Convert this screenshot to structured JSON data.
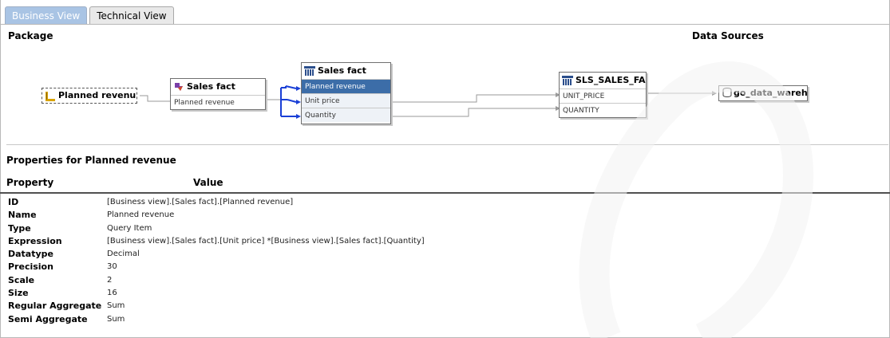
{
  "tabs": [
    {
      "label": "Business View",
      "active": false
    },
    {
      "label": "Technical View",
      "active": true
    }
  ],
  "headers": {
    "package": "Package",
    "data_sources": "Data Sources"
  },
  "diagram": {
    "query_item": {
      "label": "Planned revenu"
    },
    "sales_fact_business": {
      "title": "Sales fact",
      "rows": [
        "Planned revenue"
      ]
    },
    "sales_fact_physical": {
      "title": "Sales fact",
      "rows": [
        "Planned revenue",
        "Unit price",
        "Quantity"
      ],
      "selected_row": "Planned revenue"
    },
    "sls_table": {
      "title": "SLS_SALES_FA(",
      "rows": [
        "UNIT_PRICE",
        "QUANTITY"
      ]
    },
    "datasource": {
      "title": "go_data_wareh"
    }
  },
  "properties_title": "Properties for Planned revenue",
  "columns": {
    "property": "Property",
    "value": "Value"
  },
  "properties": [
    {
      "name": "ID",
      "value": "[Business view].[Sales fact].[Planned revenue]"
    },
    {
      "name": "Name",
      "value": "Planned revenue"
    },
    {
      "name": "Type",
      "value": "Query Item"
    },
    {
      "name": "Expression",
      "value": "[Business view].[Sales fact].[Unit price] *[Business view].[Sales fact].[Quantity]"
    },
    {
      "name": "Datatype",
      "value": "Decimal"
    },
    {
      "name": "Precision",
      "value": "30"
    },
    {
      "name": "Scale",
      "value": "2"
    },
    {
      "name": "Size",
      "value": "16"
    },
    {
      "name": "Regular Aggregate",
      "value": "Sum"
    },
    {
      "name": "Semi Aggregate",
      "value": "Sum"
    }
  ],
  "colors": {
    "tab_inactive": "#a9c4e4",
    "selected_row": "#3c6da8",
    "link_blue": "#1a3fd6"
  }
}
